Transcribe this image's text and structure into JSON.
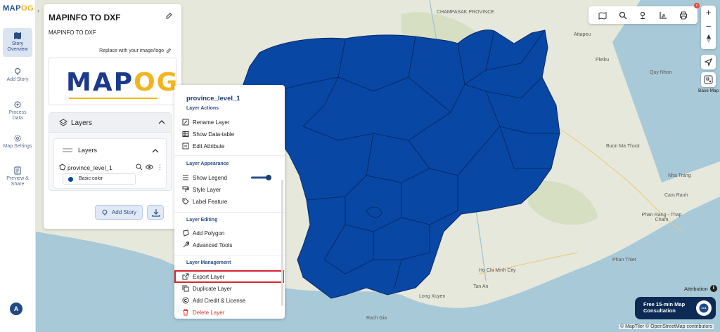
{
  "rail": {
    "logo_main": "MAP",
    "logo_accent": "OG",
    "items": [
      {
        "label": "Story Overview",
        "icon": "book-map-icon"
      },
      {
        "label": "Add Story",
        "icon": "location-pin-icon"
      },
      {
        "label": "Process Data",
        "icon": "process-gear-icon"
      },
      {
        "label": "Map Settings",
        "icon": "settings-gear-icon"
      },
      {
        "label": "Preview & Share",
        "icon": "preview-share-icon"
      }
    ],
    "avatar": "A"
  },
  "story": {
    "title": "MAPINFO TO DXF",
    "subtitle": "MAPINFO TO DXF",
    "replace_label": "Replace with your image/logo",
    "logo_text_main": "MAP",
    "logo_text_accent": "OG",
    "layers_header": "Layers",
    "layers_inner": "Layers",
    "layer_name": "province_level_1",
    "style_label": "Basic color",
    "style_color": "#0a47a3",
    "add_story_label": "Add Story"
  },
  "menu": {
    "title": "province_level_1",
    "sections": {
      "actions": "Layer Actions",
      "appearance": "Layer Appearance",
      "editing": "Layer Editing",
      "management": "Layer Management"
    },
    "items": {
      "rename": "Rename Layer",
      "datatable": "Show Data-table",
      "edit_attr": "Edit Attribute",
      "show_legend": "Show Legend",
      "style_layer": "Style Layer",
      "label_feature": "Label Feature",
      "add_polygon": "Add Polygon",
      "advanced_tools": "Advanced Tools",
      "export": "Export Layer",
      "duplicate": "Duplicate Layer",
      "credit": "Add Credit & License",
      "delete": "Delete Layer"
    },
    "show_legend_on": true
  },
  "map": {
    "labels": [
      "CHAMPASAK PROVINCE",
      "Attapeu",
      "Pleiku",
      "Quy Nhon",
      "Buon Ma Thuot",
      "Nha Trang",
      "Cam Ranh",
      "Phan Rang - Thap Cham",
      "Phan Thiet",
      "Ho Chi Minh City",
      "Tan An",
      "Long Xuyen",
      "Rach Gia"
    ],
    "basemap_label": "Base Map",
    "attribution": "Attribution",
    "consult": [
      "Free 15-min Map",
      "Consultation"
    ],
    "copyright": "© MapTiler © OpenStreetMap contributors",
    "fill_color": "#0847a4",
    "badge": "x"
  }
}
